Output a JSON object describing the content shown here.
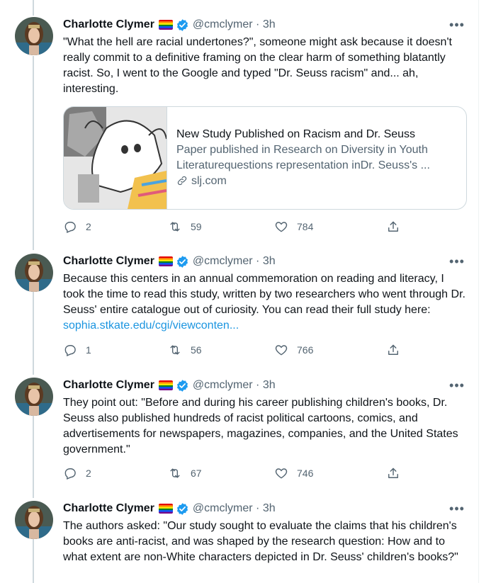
{
  "colors": {
    "accent": "#1d9bf0",
    "link": "#1b95e0",
    "muted": "#536471",
    "text": "#0f1419"
  },
  "tweets": [
    {
      "author": "Charlotte Clymer",
      "handle_time": "@cmclymer · 3h",
      "text": "\"What the hell are racial undertones?\", someone might ask because it doesn't really commit to a definitive framing on the clear harm of something blatantly racist. So, I went to the Google and typed \"Dr. Seuss racism\" and... ah, interesting.",
      "card": {
        "title": "New Study Published on Racism and Dr. Seuss",
        "description": "Paper published in Research on Diversity in Youth Literaturequestions representation inDr. Seuss's ...",
        "domain": "slj.com"
      },
      "replies": "2",
      "retweets": "59",
      "likes": "784"
    },
    {
      "author": "Charlotte Clymer",
      "handle_time": "@cmclymer · 3h",
      "text": "Because this centers in an annual commemoration on reading and literacy, I took the time to read this study, written by two researchers who went through Dr. Seuss' entire catalogue out of curiosity. You can read their full study here: ",
      "link": "sophia.stkate.edu/cgi/viewconten...",
      "replies": "1",
      "retweets": "56",
      "likes": "766"
    },
    {
      "author": "Charlotte Clymer",
      "handle_time": "@cmclymer · 3h",
      "text": "They point out: \"Before and during his career publishing children's books, Dr. Seuss also published hundreds of racist political cartoons, comics, and advertisements for newspapers, magazines, companies, and the United States government.\"",
      "replies": "2",
      "retweets": "67",
      "likes": "746"
    },
    {
      "author": "Charlotte Clymer",
      "handle_time": "@cmclymer · 3h",
      "text": "The authors asked: \"Our study sought to evaluate the claims that his children's books are anti-racist, and was shaped by the research question: How and to what extent are non-White characters depicted in Dr. Seuss' children's books?\""
    }
  ],
  "icons": {
    "more": "more-icon",
    "reply": "reply-icon",
    "retweet": "retweet-icon",
    "like": "heart-icon",
    "share": "share-icon",
    "verified": "verified-badge-icon",
    "flag": "rainbow-flag-icon",
    "link": "link-icon"
  }
}
